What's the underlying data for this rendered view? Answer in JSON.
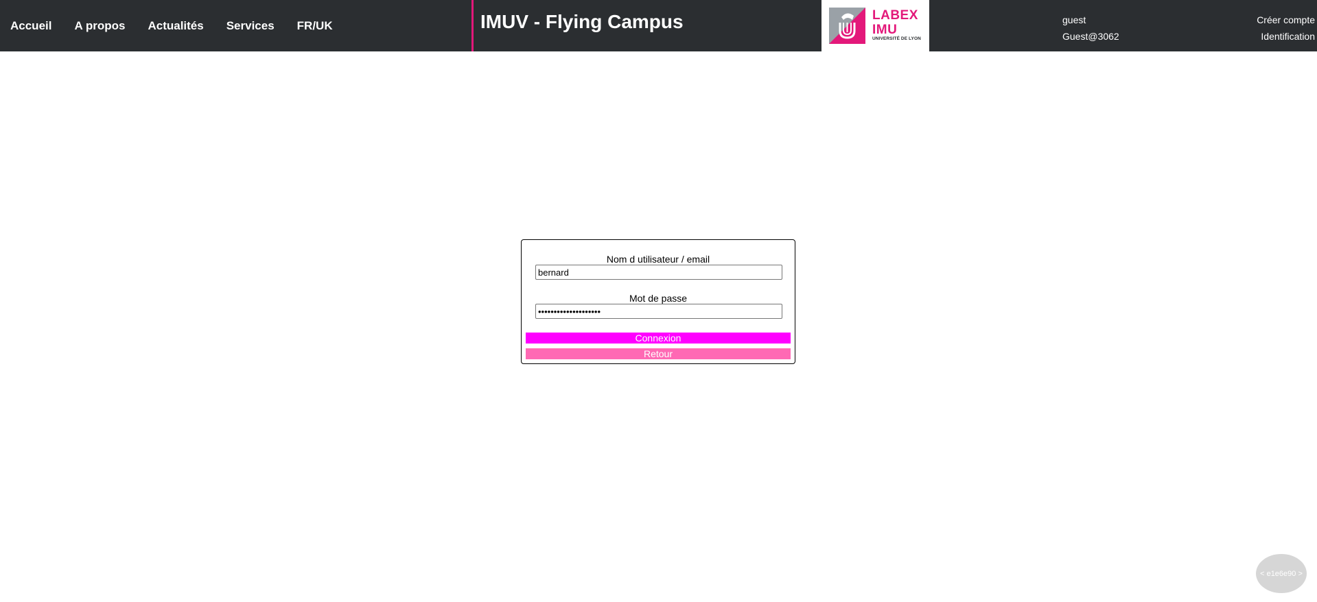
{
  "nav": {
    "items": [
      {
        "label": "Accueil"
      },
      {
        "label": "A propos"
      },
      {
        "label": "Actualités"
      },
      {
        "label": "Services"
      },
      {
        "label": "FR/UK"
      }
    ]
  },
  "header": {
    "title": "IMUV - Flying Campus"
  },
  "logo": {
    "main_text": "LABEX\nIMU",
    "sub_text": "UNIVERSITÉ DE LYON"
  },
  "user": {
    "role": "guest",
    "name": "Guest@3062"
  },
  "account": {
    "create_label": "Créer compte",
    "login_label": "Identification"
  },
  "login_form": {
    "username_label": "Nom d utilisateur / email",
    "username_value": "bernard",
    "password_label": "Mot de passe",
    "password_value": "••••••••••••••••••••",
    "connect_label": "Connexion",
    "back_label": "Retour"
  },
  "version": {
    "label": "< e1e6e90 >"
  },
  "colors": {
    "topbar": "#2b2e31",
    "accent_pink": "#e3187a",
    "connect_button": "#ff00ff",
    "back_button": "#ff69b4",
    "version_badge": "#d6d6d6"
  }
}
